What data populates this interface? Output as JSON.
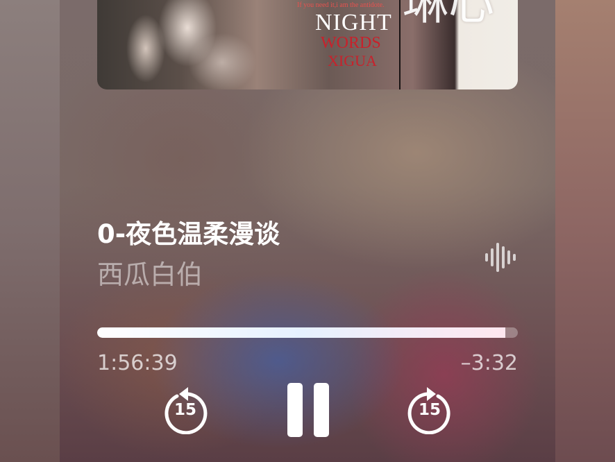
{
  "album_art": {
    "tagline": "If you need it,i am the antidote.",
    "line1": "NIGHT",
    "line2": "WORDS",
    "line3": "XIGUA",
    "glyph": "琳心"
  },
  "track": {
    "title": "0-夜色温柔漫谈",
    "artist": "西瓜白伯"
  },
  "playback": {
    "elapsed": "1:56:39",
    "remaining": "–3:32",
    "progress_fraction": 0.97
  },
  "controls": {
    "skip_back_seconds": "15",
    "skip_forward_seconds": "15"
  },
  "icons": {
    "waveform": "waveform-icon",
    "skip_back": "skip-back-15-icon",
    "pause": "pause-icon",
    "skip_forward": "skip-forward-15-icon"
  },
  "colors": {
    "text_primary": "#ffffff",
    "text_secondary": "rgba(255,255,255,0.5)",
    "art_red": "#c8212b"
  }
}
